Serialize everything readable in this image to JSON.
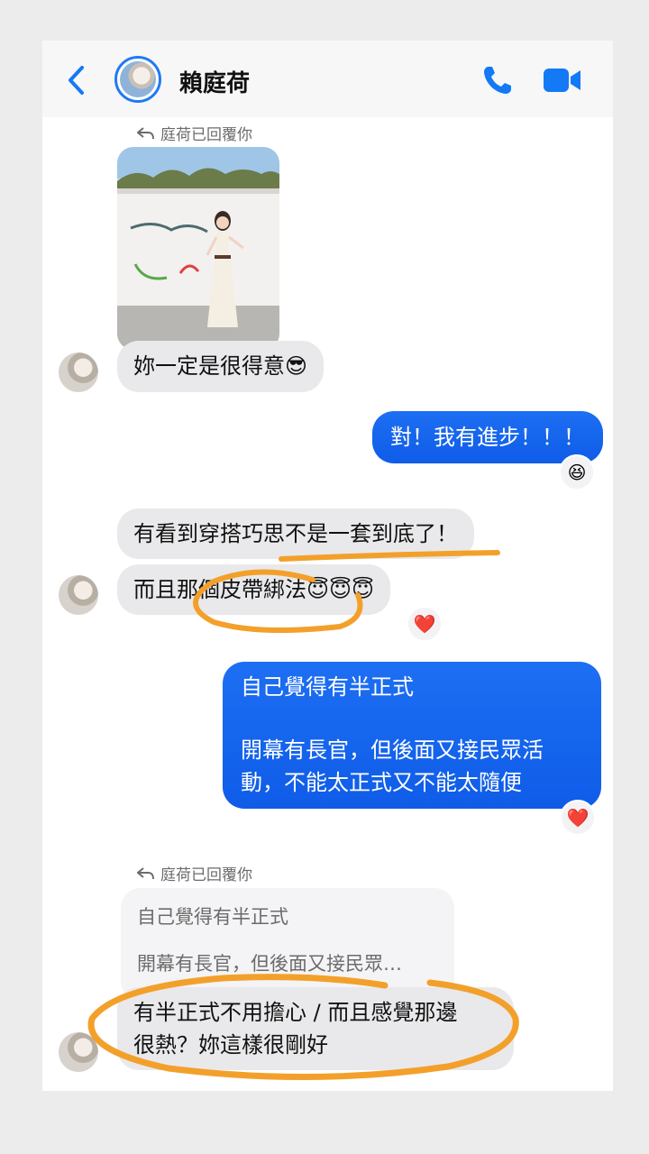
{
  "header": {
    "contact_name": "賴庭荷"
  },
  "reply_notes": {
    "first": "庭荷已回覆你",
    "second": "庭荷已回覆你"
  },
  "messages": {
    "m1": "妳一定是很得意😎",
    "m2": "對！我有進步！！！",
    "m2_reaction": "😆",
    "m3": "有看到穿搭巧思不是一套到底了！",
    "m4": "而且那個皮帶綁法😇😇😇",
    "m4_reaction": "❤️",
    "m5_line1": "自己覺得有半正式",
    "m5_line2": "開幕有長官，但後面又接民眾活",
    "m5_line3": "動，不能太正式又不能太隨便",
    "m5_reaction": "❤️",
    "quote_line1": "自己覺得有半正式",
    "quote_line2": "開幕有長官，但後面又接民眾…",
    "m6_line1": "有半正式不用擔心 / 而且感覺那邊",
    "m6_line2": "很熱？妳這樣很剛好"
  },
  "colors": {
    "accent_blue": "#1479f5",
    "outgoing_bubble": "#1468f0",
    "incoming_bubble": "#e9e9eb",
    "annotation_orange": "#f3a02b"
  },
  "icons": {
    "back": "chevron-left-icon",
    "phone": "phone-icon",
    "video": "video-camera-icon",
    "reply": "reply-arrow-icon"
  }
}
